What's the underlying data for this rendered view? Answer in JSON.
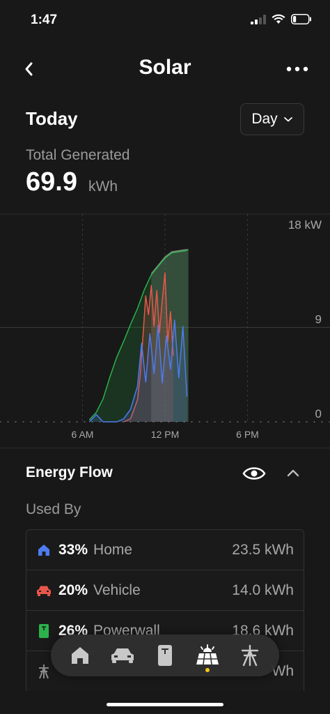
{
  "status_bar": {
    "time": "1:47",
    "battery_level": 0.2
  },
  "nav": {
    "title": "Solar"
  },
  "period": {
    "heading": "Today",
    "selector": "Day"
  },
  "summary": {
    "label": "Total Generated",
    "value": "69.9",
    "unit": "kWh"
  },
  "chart_data": {
    "type": "area",
    "x_ticks": [
      "6 AM",
      "12 PM",
      "6 PM"
    ],
    "y_ticks": [
      "18 kW",
      "9",
      "0"
    ],
    "ylim": [
      0,
      18
    ],
    "xlim_hours": [
      0,
      24
    ],
    "grid": true,
    "colors": {
      "solar": "#2bb24c",
      "powerwall": "#e8574c",
      "home": "#4d7cf0",
      "grid": "#8a8a8a"
    },
    "series": [
      {
        "key": "solar",
        "x": [
          6.5,
          7.0,
          7.5,
          8.0,
          8.5,
          9.0,
          9.5,
          10.0,
          10.5,
          11.0,
          11.5,
          12.0,
          12.5,
          13.0,
          13.5,
          13.7
        ],
        "y": [
          0.2,
          0.9,
          2.2,
          4.3,
          6.2,
          7.7,
          9.3,
          10.8,
          12.6,
          14.0,
          14.8,
          15.6,
          16.1,
          16.2,
          16.3,
          16.4
        ]
      },
      {
        "key": "powerwall",
        "x": [
          9.0,
          9.5,
          10.0,
          10.2,
          10.4,
          10.6,
          10.8,
          11.0,
          11.2,
          11.4,
          11.6,
          11.8,
          12.0,
          12.2,
          12.4,
          12.6
        ],
        "y": [
          0.0,
          0.3,
          2.1,
          4.5,
          8.2,
          12.0,
          10.2,
          13.0,
          9.1,
          12.5,
          8.5,
          11.6,
          14.2,
          7.6,
          10.5,
          6.3
        ]
      },
      {
        "key": "home",
        "x": [
          6.5,
          7.0,
          7.5,
          8.0,
          8.5,
          9.0,
          9.5,
          10.0,
          10.3,
          10.6,
          10.9,
          11.2,
          11.5,
          11.8,
          12.1,
          12.4,
          12.7,
          13.0,
          13.3,
          13.6
        ],
        "y": [
          0.0,
          0.7,
          0.0,
          0.0,
          0.0,
          0.3,
          1.2,
          3.4,
          7.5,
          3.8,
          8.4,
          4.6,
          9.2,
          3.7,
          8.2,
          5.0,
          9.7,
          4.2,
          9.1,
          2.4
        ]
      },
      {
        "key": "grid",
        "x": [
          11.0,
          11.5,
          12.0,
          12.5,
          13.0,
          13.5,
          13.7
        ],
        "y": [
          14.1,
          14.9,
          15.7,
          16.2,
          16.3,
          16.4,
          16.4
        ]
      }
    ]
  },
  "energy_flow": {
    "title": "Energy Flow",
    "subtitle": "Used By",
    "rows": [
      {
        "icon": "home-icon",
        "color": "#4d7cf0",
        "percent": "33%",
        "name": "Home",
        "value": "23.5 kWh"
      },
      {
        "icon": "car-icon",
        "color": "#e8574c",
        "percent": "20%",
        "name": "Vehicle",
        "value": "14.0 kWh"
      },
      {
        "icon": "powerwall-icon",
        "color": "#2bb24c",
        "percent": "26%",
        "name": "Powerwall",
        "value": "18.6 kWh"
      },
      {
        "icon": "grid-tower-icon",
        "color": "#8a8a8a",
        "percent": "",
        "name": "",
        "value": "Wh"
      }
    ]
  },
  "tab_bar": {
    "tabs": [
      {
        "icon": "home-icon",
        "active": false
      },
      {
        "icon": "car-icon",
        "active": false
      },
      {
        "icon": "powerwall-icon",
        "active": false
      },
      {
        "icon": "solar-panel-icon",
        "active": true
      },
      {
        "icon": "grid-tower-icon",
        "active": false
      }
    ]
  }
}
